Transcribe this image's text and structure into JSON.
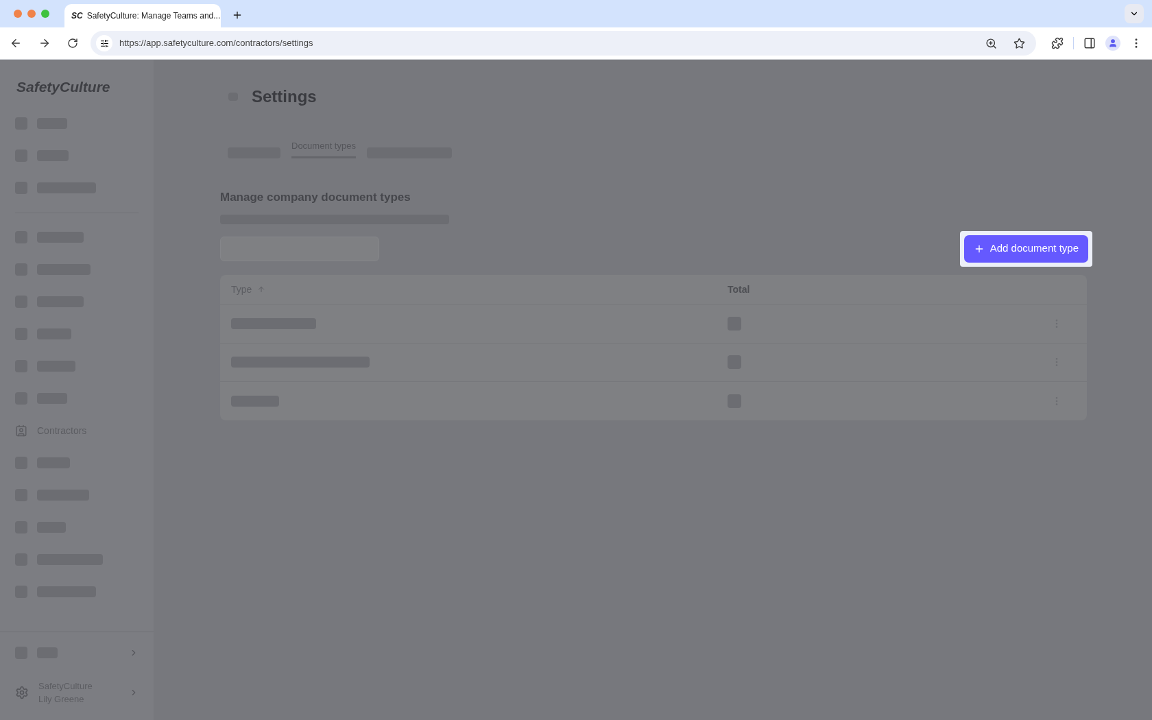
{
  "browser": {
    "favicon": "SC",
    "tab_title": "SafetyCulture: Manage Teams and...",
    "url": "https://app.safetyculture.com/contractors/settings"
  },
  "sidebar": {
    "logo": "SafetyCulture",
    "items": [
      {
        "label": "Contractors",
        "selected": false
      }
    ],
    "org": "SafetyCulture",
    "user": "Lily Greene"
  },
  "page": {
    "title": "Settings",
    "tabs": [
      {
        "label": "Document types",
        "selected": true
      }
    ],
    "section_title": "Manage company document types",
    "add_button": "Add document type"
  },
  "table": {
    "columns": [
      {
        "label": "Type",
        "sorted": true
      },
      {
        "label": "Total",
        "sorted": false
      }
    ]
  }
}
